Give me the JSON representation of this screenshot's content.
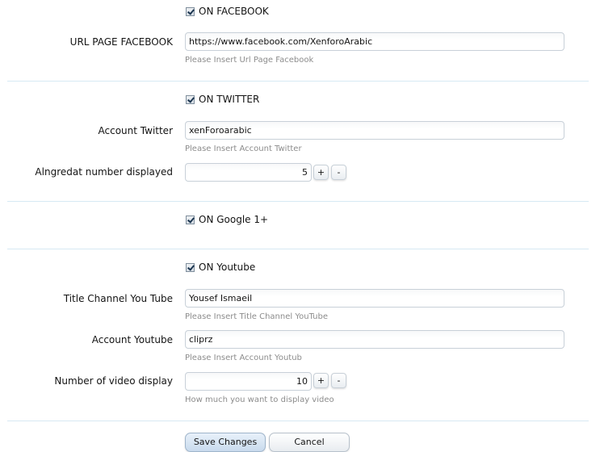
{
  "facebook": {
    "enable_label": "ON FACEBOOK",
    "enabled": true,
    "url_label": "URL PAGE FACEBOOK",
    "url_value": "https://www.facebook.com/XenforoArabic",
    "url_hint": "Please Insert Url Page Facebook"
  },
  "twitter": {
    "enable_label": "ON TWITTER",
    "enabled": true,
    "account_label": "Account Twitter",
    "account_value": "xenForoarabic",
    "account_hint": "Please Insert Account Twitter",
    "number_label": "Alngredat number displayed",
    "number_value": "5",
    "plus_label": "+",
    "minus_label": "-"
  },
  "google": {
    "enable_label": "ON Google 1+",
    "enabled": true
  },
  "youtube": {
    "enable_label": "ON Youtube",
    "enabled": true,
    "title_label": "Title Channel You Tube",
    "title_value": "Yousef Ismaeil",
    "title_hint": "Please Insert Title Channel YouTube",
    "account_label": "Account Youtube",
    "account_value": "cliprz",
    "account_hint": "Please Insert Account Youtub",
    "number_label": "Number of video display",
    "number_value": "10",
    "number_hint": "How much you want to display video",
    "plus_label": "+",
    "minus_label": "-"
  },
  "actions": {
    "save_label": "Save Changes",
    "cancel_label": "Cancel"
  }
}
